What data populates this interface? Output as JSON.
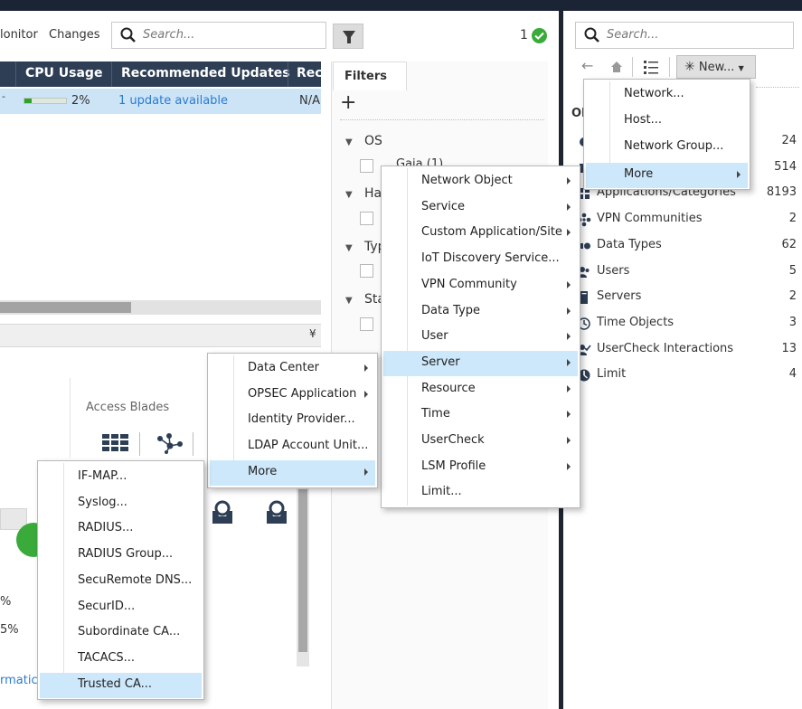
{
  "toolbar": {
    "monitor_label": "lonitor",
    "changes_label": "Changes",
    "search_placeholder": "Search...",
    "status_count": "1"
  },
  "grid": {
    "columns": [
      "CPU Usage",
      "Recommended Updates",
      "Rec"
    ],
    "row": {
      "cpu_percent": "2%",
      "cpu_value": 0.18,
      "updates": "1 update available",
      "rec": "N/A"
    }
  },
  "lower_panel": {
    "access_blades_label": "Access Blades",
    "pct_line1": "%",
    "pct_line2": "5%",
    "info_link": "rmatic"
  },
  "filters": {
    "tab_label": "Filters",
    "add_label": "+",
    "groups": [
      {
        "label": "OS",
        "sub": "Gaia (1)"
      },
      {
        "label": "Ha"
      },
      {
        "label": "Typ"
      },
      {
        "label": "Sta"
      }
    ]
  },
  "right_panel": {
    "search_placeholder": "Search...",
    "new_button": "New...",
    "objects_header": "Ol",
    "objects": [
      {
        "name": "",
        "count": "24",
        "icon": "network-icon"
      },
      {
        "name": "",
        "count": "514",
        "icon": "services-icon"
      },
      {
        "name": "Applications/Categories",
        "count": "8193",
        "icon": "applications-icon"
      },
      {
        "name": "VPN Communities",
        "count": "2",
        "icon": "vpn-icon"
      },
      {
        "name": "Data Types",
        "count": "62",
        "icon": "datatype-icon"
      },
      {
        "name": "Users",
        "count": "5",
        "icon": "users-icon"
      },
      {
        "name": "Servers",
        "count": "2",
        "icon": "server-icon"
      },
      {
        "name": "Time Objects",
        "count": "3",
        "icon": "clock-icon"
      },
      {
        "name": "UserCheck Interactions",
        "count": "13",
        "icon": "usercheck-icon"
      },
      {
        "name": "Limit",
        "count": "4",
        "icon": "limit-icon"
      }
    ]
  },
  "menus": {
    "new_menu": [
      "Network...",
      "Host...",
      "Network Group...",
      "More"
    ],
    "object_menu": [
      "Network Object",
      "Service",
      "Custom Application/Site",
      "IoT Discovery Service...",
      "VPN Community",
      "Data Type",
      "User",
      "Server",
      "Resource",
      "Time",
      "UserCheck",
      "LSM Profile",
      "Limit..."
    ],
    "server_menu": [
      "Data Center",
      "OPSEC Application",
      "Identity Provider...",
      "LDAP Account Unit...",
      "More"
    ],
    "more_menu": [
      "IF-MAP...",
      "Syslog...",
      "RADIUS...",
      "RADIUS Group...",
      "SecuRemote DNS...",
      "SecurID...",
      "Subordinate CA...",
      "TACACS...",
      "Trusted CA..."
    ]
  }
}
